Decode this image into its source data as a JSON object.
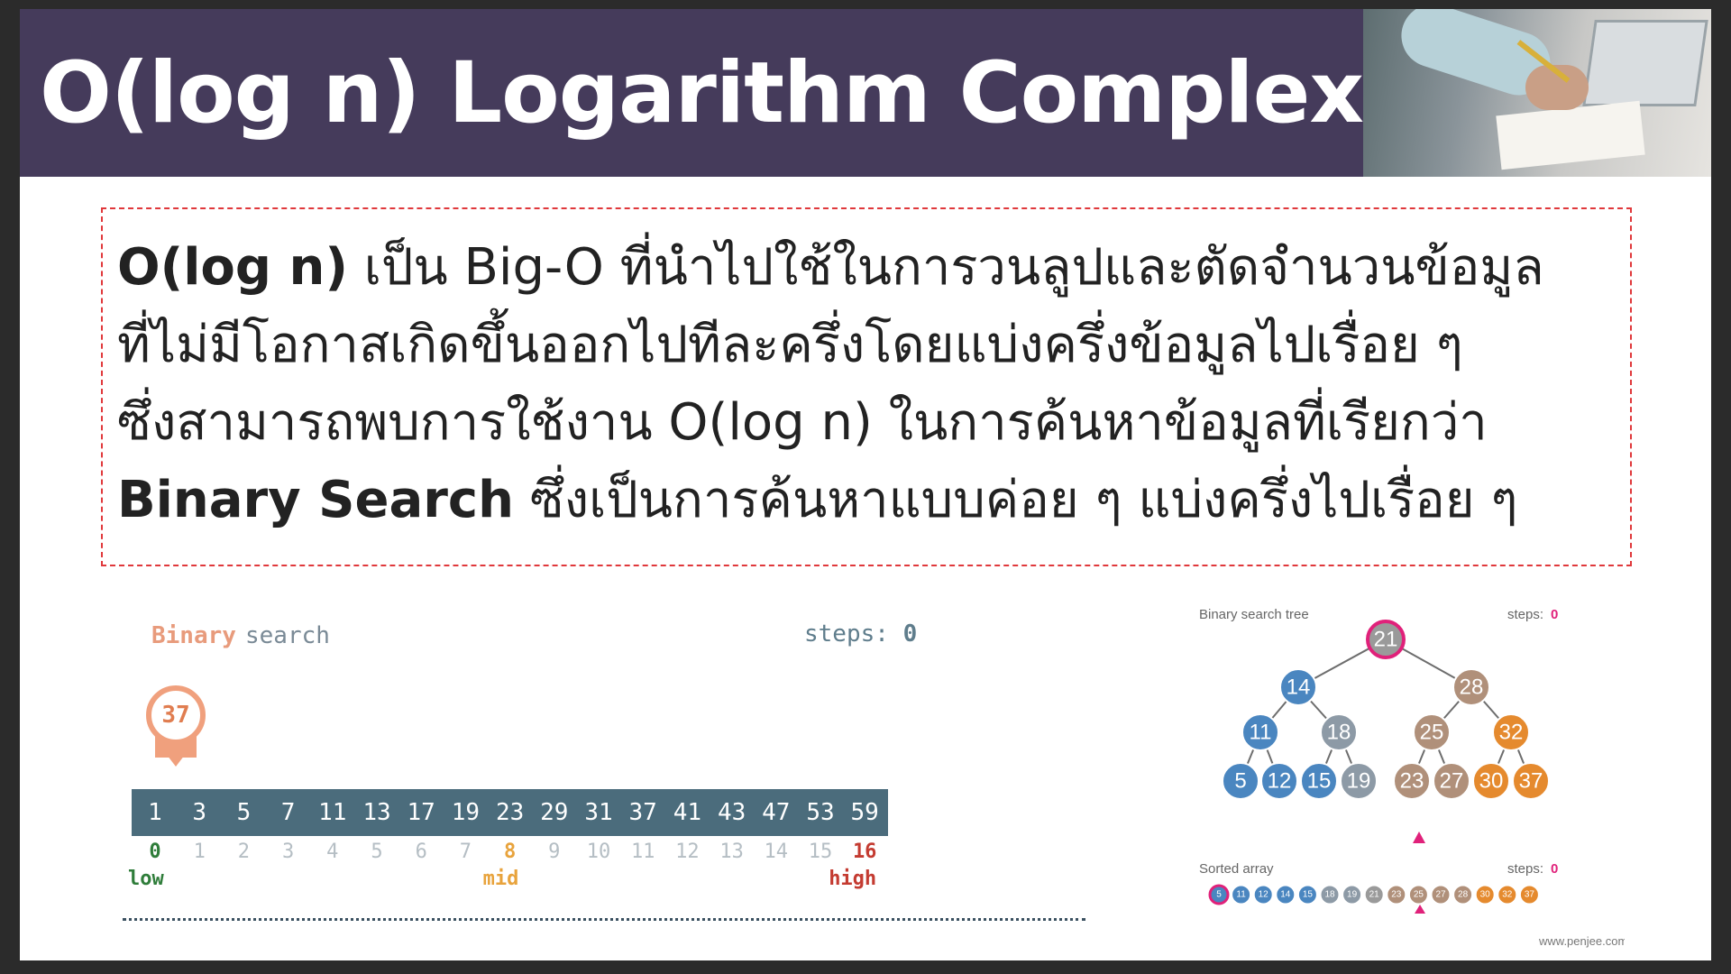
{
  "slide": {
    "title": "O(log n) Logarithm Complexity",
    "lines": [
      {
        "bold": "O(log n)",
        "text": " เป็น Big-O ที่นำไปใช้ในการวนลูปและตัดจำนวนข้อมูล"
      },
      {
        "bold": "",
        "text": "ที่ไม่มีโอกาสเกิดขึ้นออกไปทีละครึ่งโดยแบ่งครึ่งข้อมูลไปเรื่อย ๆ"
      },
      {
        "bold": "",
        "text": "ซึ่งสามารถพบการใช้งาน O(log n) ในการค้นหาข้อมูลที่เรียกว่า"
      },
      {
        "bold": "Binary Search",
        "text": " ซึ่งเป็นการค้นหาแบบค่อย ๆ แบ่งครึ่งไปเรื่อย ๆ"
      }
    ]
  },
  "binary_search": {
    "title_part1": "Binary",
    "title_part2": "search",
    "steps_label": "steps:",
    "steps_value": "0",
    "target": "37",
    "array": [
      "1",
      "3",
      "5",
      "7",
      "11",
      "13",
      "17",
      "19",
      "23",
      "29",
      "31",
      "37",
      "41",
      "43",
      "47",
      "53",
      "59"
    ],
    "indices": [
      "0",
      "1",
      "2",
      "3",
      "4",
      "5",
      "6",
      "7",
      "8",
      "9",
      "10",
      "11",
      "12",
      "13",
      "14",
      "15",
      "16"
    ],
    "low_index": 0,
    "mid_index": 8,
    "high_index": 16,
    "low_label": "low",
    "mid_label": "mid",
    "high_label": "high",
    "colors": {
      "cell": "#4b6c7c",
      "low": "#2f7d3a",
      "mid": "#e8a33c",
      "high": "#c43b31",
      "target": "#f0a07d"
    }
  },
  "bst": {
    "title": "Binary search tree",
    "steps_label": "steps:",
    "steps_value": "0",
    "root": "21",
    "nodes": {
      "n21": "21",
      "n14": "14",
      "n28": "28",
      "n11": "11",
      "n18": "18",
      "n25": "25",
      "n32": "32",
      "n5": "5",
      "n12": "12",
      "n15": "15",
      "n19": "19",
      "n23": "23",
      "n27": "27",
      "n30": "30",
      "n37": "37"
    },
    "sorted_title": "Sorted array",
    "sorted_steps_label": "steps:",
    "sorted_steps_value": "0",
    "sorted": [
      "5",
      "11",
      "12",
      "14",
      "15",
      "18",
      "19",
      "21",
      "23",
      "25",
      "27",
      "28",
      "30",
      "32",
      "37"
    ],
    "site": "www.penjee.com",
    "colors": {
      "blue": "#4a86c0",
      "gray": "#8d9aa6",
      "brown": "#b0907a",
      "orange": "#e58a2e",
      "root": "#9a9a9a",
      "highlight": "#e0217a"
    }
  }
}
